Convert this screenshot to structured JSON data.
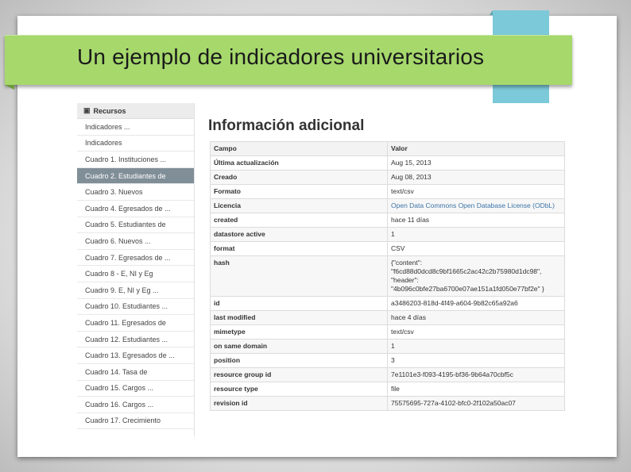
{
  "slide": {
    "title": "Un ejemplo de indicadores universitarios"
  },
  "sidebar": {
    "header": "Recursos",
    "items": [
      "Indicadores ...",
      "Indicadores",
      "Cuadro 1. Instituciones ...",
      "Cuadro 2. Estudiantes de",
      "Cuadro 3. Nuevos",
      "Cuadro 4. Egresados de ...",
      "Cuadro 5. Estudiantes de",
      "Cuadro 6. Nuevos ...",
      "Cuadro 7. Egresados de ...",
      "Cuadro 8 - E, NI y Eg",
      "Cuadro 9. E, NI y Eg ...",
      "Cuadro 10. Estudiantes ...",
      "Cuadro 11. Egresados de",
      "Cuadro 12. Estudiantes ...",
      "Cuadro 13. Egresados de ...",
      "Cuadro 14. Tasa de",
      "Cuadro 15. Cargos ...",
      "Cuadro 16. Cargos ...",
      "Cuadro 17. Crecimiento"
    ],
    "active_index": 3
  },
  "main": {
    "heading": "Información adicional",
    "columns": [
      "Campo",
      "Valor"
    ],
    "rows": [
      {
        "field": "Última actualización",
        "value": "Aug 15, 2013"
      },
      {
        "field": "Creado",
        "value": "Aug 08, 2013"
      },
      {
        "field": "Formato",
        "value": "text/csv"
      },
      {
        "field": "Licencia",
        "value": "Open Data Commons Open Database License (ODbL)",
        "link": true
      },
      {
        "field": "created",
        "value": "hace 11 días"
      },
      {
        "field": "datastore active",
        "value": "1"
      },
      {
        "field": "format",
        "value": "CSV"
      },
      {
        "field": "hash",
        "value": "{\"content\": \"f6cd88d0dcd8c9bf1665c2ac42c2b75980d1dc98\", \"header\": \"4b096c0bfe27ba6700e07ae151a1fd050e77bf2e\" }"
      },
      {
        "field": "id",
        "value": "a3486203-818d-4f49-a604-9b82c65a92a6"
      },
      {
        "field": "last modified",
        "value": "hace 4 días"
      },
      {
        "field": "mimetype",
        "value": "text/csv"
      },
      {
        "field": "on same domain",
        "value": "1"
      },
      {
        "field": "position",
        "value": "3"
      },
      {
        "field": "resource group id",
        "value": "7e1101e3-f093-4195-bf36-9b64a70cbf5c"
      },
      {
        "field": "resource type",
        "value": "file"
      },
      {
        "field": "revision id",
        "value": "75575695-727a-4102-bfc0-2f102a50ac07"
      }
    ]
  },
  "colors": {
    "title_bar": "#a6d86c",
    "accent_tab": "#7cc9d9",
    "sidebar_active": "#808e97",
    "link": "#3b74a6"
  }
}
